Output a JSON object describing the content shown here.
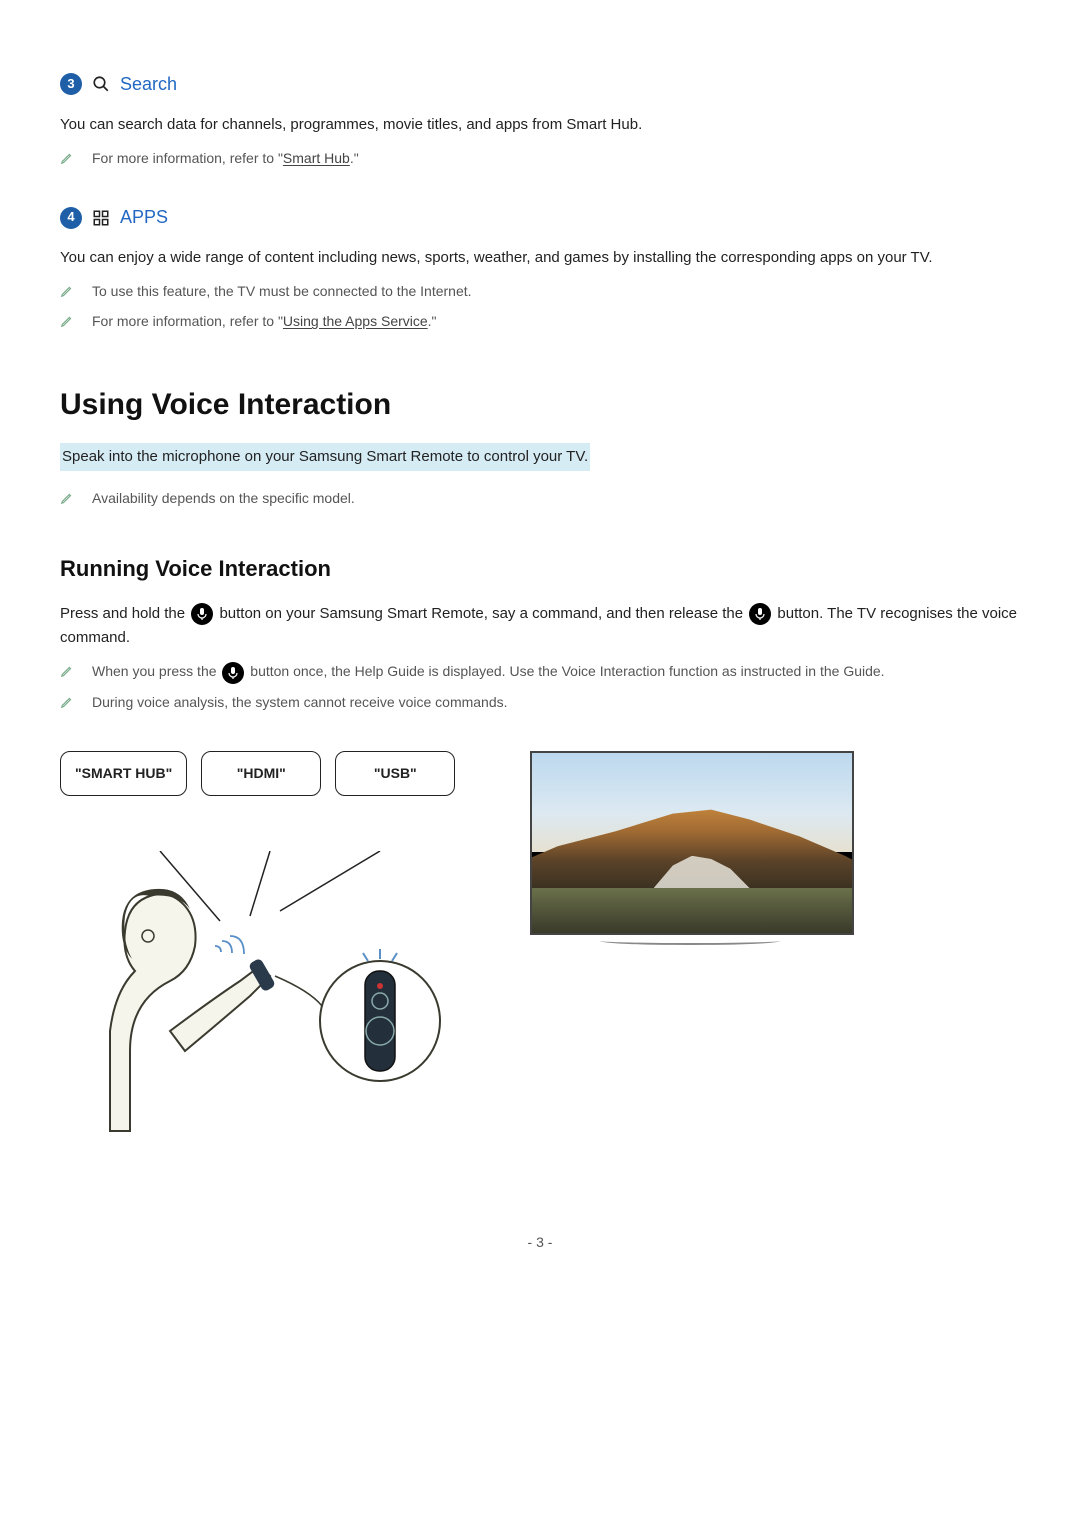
{
  "section3": {
    "num": "3",
    "title": "Search",
    "body": "You can search data for channels, programmes, movie titles, and apps from Smart Hub.",
    "note_prefix": "For more information, refer to \"",
    "note_link": "Smart Hub",
    "note_suffix": ".\""
  },
  "section4": {
    "num": "4",
    "title": "APPS",
    "body": "You can enjoy a wide range of content including news, sports, weather, and games by installing the corresponding apps on your TV.",
    "note1": "To use this feature, the TV must be connected to the Internet.",
    "note2_prefix": "For more information, refer to \"",
    "note2_link": "Using the Apps Service",
    "note2_suffix": ".\""
  },
  "voice": {
    "title": "Using Voice Interaction",
    "subtitle": "Speak into the microphone on your Samsung Smart Remote to control your TV.",
    "note": "Availability depends on the specific model."
  },
  "running": {
    "title": "Running Voice Interaction",
    "p1_a": "Press and hold the ",
    "p1_b": " button on your Samsung Smart Remote, say a command, and then release the ",
    "p1_c": " button. The TV recognises the voice command.",
    "note1_a": "When you press the ",
    "note1_b": " button once, the Help Guide is displayed. Use the Voice Interaction function as instructed in the Guide.",
    "note2": "During voice analysis, the system cannot receive voice commands."
  },
  "commands": {
    "c1": "\"SMART HUB\"",
    "c2": "\"HDMI\"",
    "c3": "\"USB\""
  },
  "page": "- 3 -"
}
